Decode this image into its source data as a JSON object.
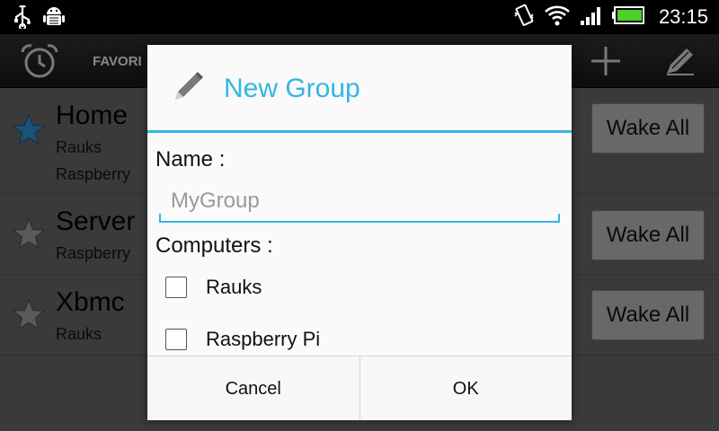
{
  "status_bar": {
    "time": "23:15",
    "icons": [
      "usb-icon",
      "android-debug-icon",
      "vibrate-icon",
      "wifi-icon",
      "signal-icon",
      "battery-icon"
    ]
  },
  "action_bar": {
    "tab_label": "FAVORI",
    "icons": [
      "alarm-clock-icon",
      "plus-icon",
      "edit-icon"
    ]
  },
  "list": {
    "items": [
      {
        "title": "Home",
        "subtitles": [
          "Rauks",
          "Raspberry"
        ],
        "favorite": true,
        "button": "Wake All"
      },
      {
        "title": "Server",
        "subtitles": [
          "Raspberry"
        ],
        "favorite": false,
        "button": "Wake All"
      },
      {
        "title": "Xbmc",
        "subtitles": [
          "Rauks"
        ],
        "favorite": false,
        "button": "Wake All"
      }
    ]
  },
  "dialog": {
    "title": "New Group",
    "name_label": "Name :",
    "name_value": "",
    "name_placeholder": "MyGroup",
    "computers_label": "Computers :",
    "computers": [
      {
        "label": "Rauks",
        "checked": false
      },
      {
        "label": "Raspberry Pi",
        "checked": false
      }
    ],
    "cancel_label": "Cancel",
    "ok_label": "OK"
  },
  "colors": {
    "accent": "#33b5e5",
    "favorite_star": "#2b7fb8",
    "battery": "#4cd12b"
  }
}
